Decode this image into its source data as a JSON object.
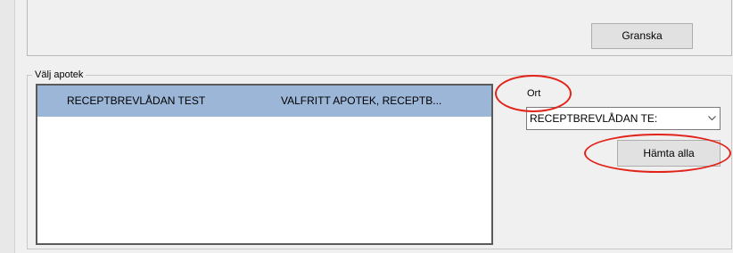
{
  "top_panel": {
    "granska_label": "Granska"
  },
  "pharmacy_group": {
    "legend": "Välj apotek",
    "list": {
      "rows": [
        {
          "name": "RECEPTBREVLÅDAN TEST",
          "description": "VALFRITT APOTEK, RECEPTB...",
          "selected": true
        }
      ]
    },
    "ort": {
      "label": "Ort",
      "selected_value": "RECEPTBREVLÅDAN TE:"
    },
    "hamta_alla_label": "Hämta alla"
  },
  "annotations": {
    "color": "#e2231a"
  },
  "icons": {
    "dropdown": "chevron-down-icon"
  }
}
